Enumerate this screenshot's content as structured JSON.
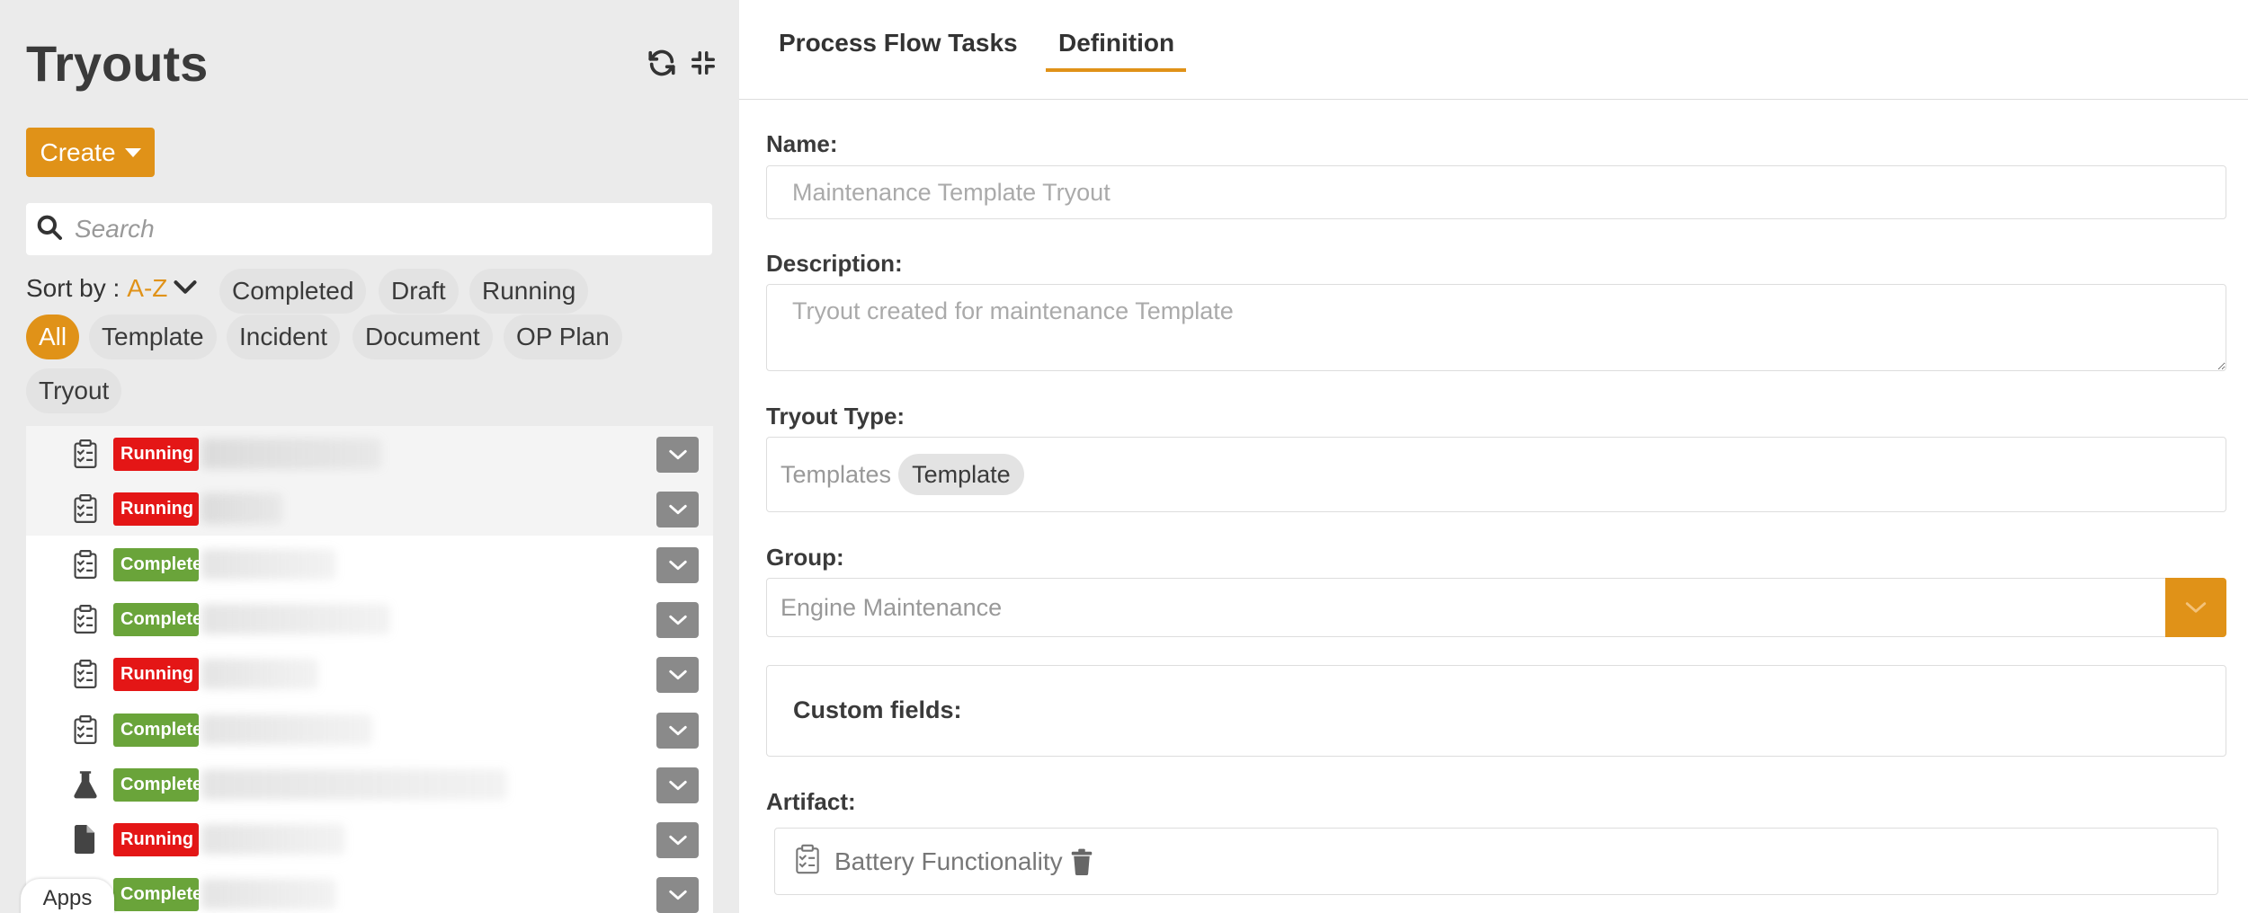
{
  "sidebar": {
    "title": "Tryouts",
    "create_label": "Create",
    "search_placeholder": "Search",
    "sort_label": "Sort by :",
    "sort_value": "A-Z",
    "filters": [
      "Completed",
      "Draft",
      "Running",
      "All",
      "Template",
      "Incident",
      "Document",
      "OP Plan",
      "Tryout"
    ],
    "active_filter": "All",
    "rows": [
      {
        "status": "Running",
        "icon": "checklist-icon"
      },
      {
        "status": "Running",
        "icon": "checklist-icon"
      },
      {
        "status": "Completed",
        "icon": "checklist-icon"
      },
      {
        "status": "Completed",
        "icon": "checklist-icon"
      },
      {
        "status": "Running",
        "icon": "checklist-icon"
      },
      {
        "status": "Completed",
        "icon": "checklist-icon"
      },
      {
        "status": "Completed",
        "icon": "flask-icon"
      },
      {
        "status": "Running",
        "icon": "document-icon"
      },
      {
        "status": "Completed",
        "icon": "checklist-icon"
      }
    ],
    "apps_label": "Apps"
  },
  "tabs": [
    {
      "label": "Process Flow Tasks",
      "active": false
    },
    {
      "label": "Definition",
      "active": true
    }
  ],
  "form": {
    "name_label": "Name:",
    "name_placeholder": "Maintenance Template Tryout",
    "description_label": "Description:",
    "description_placeholder": "Tryout created for maintenance Template",
    "type_label": "Tryout Type:",
    "type_prefix": "Templates",
    "type_tag": "Template",
    "group_label": "Group:",
    "group_value": "Engine Maintenance",
    "custom_fields_label": "Custom fields:",
    "artifact_label": "Artifact:",
    "artifact_name": "Battery Functionality"
  },
  "colors": {
    "accent": "#e09218",
    "running": "#e41616",
    "completed": "#6aa43a"
  }
}
